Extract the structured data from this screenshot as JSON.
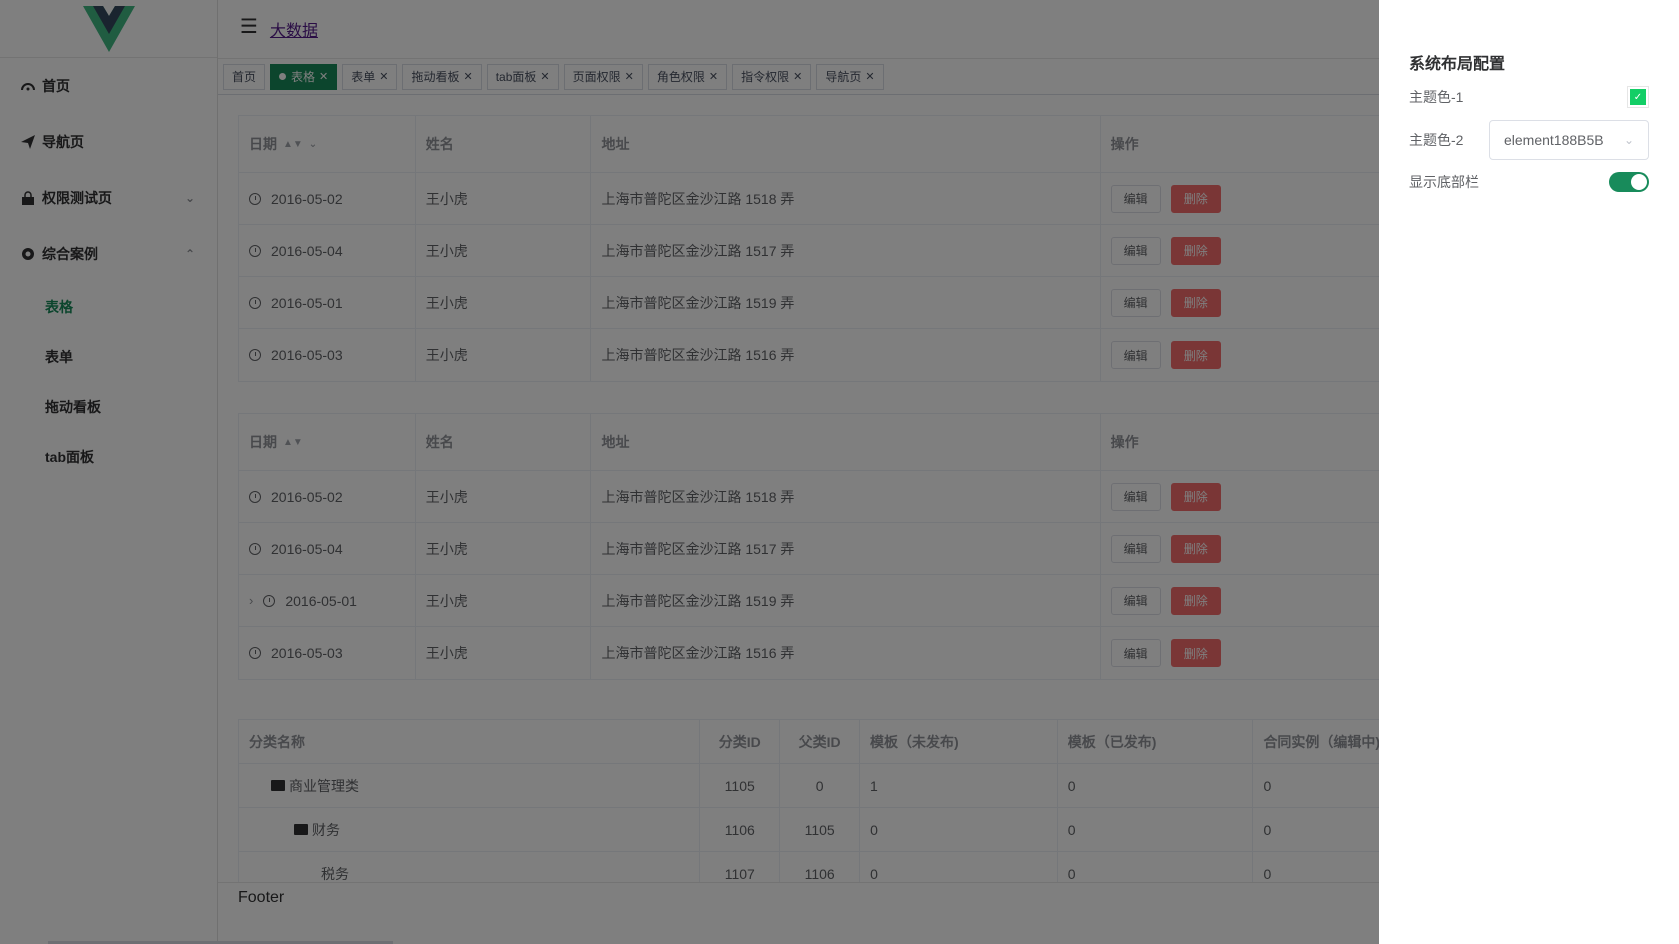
{
  "header": {
    "breadcrumb_link": "大数据"
  },
  "sidebar": {
    "items": [
      {
        "label": "首页",
        "icon": "dashboard-icon"
      },
      {
        "label": "导航页",
        "icon": "paper-plane-icon"
      },
      {
        "label": "权限测试页",
        "icon": "lock-icon",
        "expanded": false
      },
      {
        "label": "综合案例",
        "icon": "gear-icon",
        "expanded": true
      }
    ],
    "subitems": [
      {
        "label": "表格",
        "active": true
      },
      {
        "label": "表单"
      },
      {
        "label": "拖动看板"
      },
      {
        "label": "tab面板"
      }
    ]
  },
  "tags": [
    {
      "label": "首页",
      "active": false,
      "closable": false
    },
    {
      "label": "表格",
      "active": true,
      "closable": true
    },
    {
      "label": "表单",
      "closable": true
    },
    {
      "label": "拖动看板",
      "closable": true
    },
    {
      "label": "tab面板",
      "closable": true
    },
    {
      "label": "页面权限",
      "closable": true
    },
    {
      "label": "角色权限",
      "closable": true
    },
    {
      "label": "指令权限",
      "closable": true
    },
    {
      "label": "导航页",
      "closable": true
    }
  ],
  "table1": {
    "headers": [
      "日期",
      "姓名",
      "地址",
      "操作"
    ],
    "rows": [
      {
        "date": "2016-05-02",
        "name": "王小虎",
        "address": "上海市普陀区金沙江路 1518 弄"
      },
      {
        "date": "2016-05-04",
        "name": "王小虎",
        "address": "上海市普陀区金沙江路 1517 弄"
      },
      {
        "date": "2016-05-01",
        "name": "王小虎",
        "address": "上海市普陀区金沙江路 1519 弄"
      },
      {
        "date": "2016-05-03",
        "name": "王小虎",
        "address": "上海市普陀区金沙江路 1516 弄"
      }
    ],
    "edit_label": "编辑",
    "delete_label": "删除"
  },
  "table2": {
    "headers": [
      "日期",
      "姓名",
      "地址",
      "操作"
    ],
    "rows": [
      {
        "date": "2016-05-02",
        "name": "王小虎",
        "address": "上海市普陀区金沙江路 1518 弄"
      },
      {
        "date": "2016-05-04",
        "name": "王小虎",
        "address": "上海市普陀区金沙江路 1517 弄"
      },
      {
        "date": "2016-05-01",
        "name": "王小虎",
        "address": "上海市普陀区金沙江路 1519 弄",
        "expandable": true
      },
      {
        "date": "2016-05-03",
        "name": "王小虎",
        "address": "上海市普陀区金沙江路 1516 弄"
      }
    ],
    "edit_label": "编辑",
    "delete_label": "删除"
  },
  "table3": {
    "headers": [
      "分类名称",
      "分类ID",
      "父类ID",
      "模板（未发布)",
      "模板（已发布)",
      "合同实例（编辑中)"
    ],
    "rows": [
      {
        "name": "商业管理类",
        "id": "1105",
        "pid": "0",
        "t1": "1",
        "t2": "0",
        "t3": "0",
        "level": 0,
        "folder": true
      },
      {
        "name": "财务",
        "id": "1106",
        "pid": "1105",
        "t1": "0",
        "t2": "0",
        "t3": "0",
        "level": 1,
        "folder": true
      },
      {
        "name": "税务",
        "id": "1107",
        "pid": "1106",
        "t1": "0",
        "t2": "0",
        "t3": "0",
        "level": 2,
        "folder": false
      }
    ]
  },
  "footer": {
    "text": "Footer"
  },
  "drawer": {
    "title": "系统布局配置",
    "theme1_label": "主题色-1",
    "theme1_color": "#13ce66",
    "theme2_label": "主题色-2",
    "theme2_value": "element188B5B",
    "footer_toggle_label": "显示底部栏",
    "footer_toggle_on": true
  },
  "colors": {
    "accent": "#188b5b",
    "danger": "#f56c6c"
  }
}
